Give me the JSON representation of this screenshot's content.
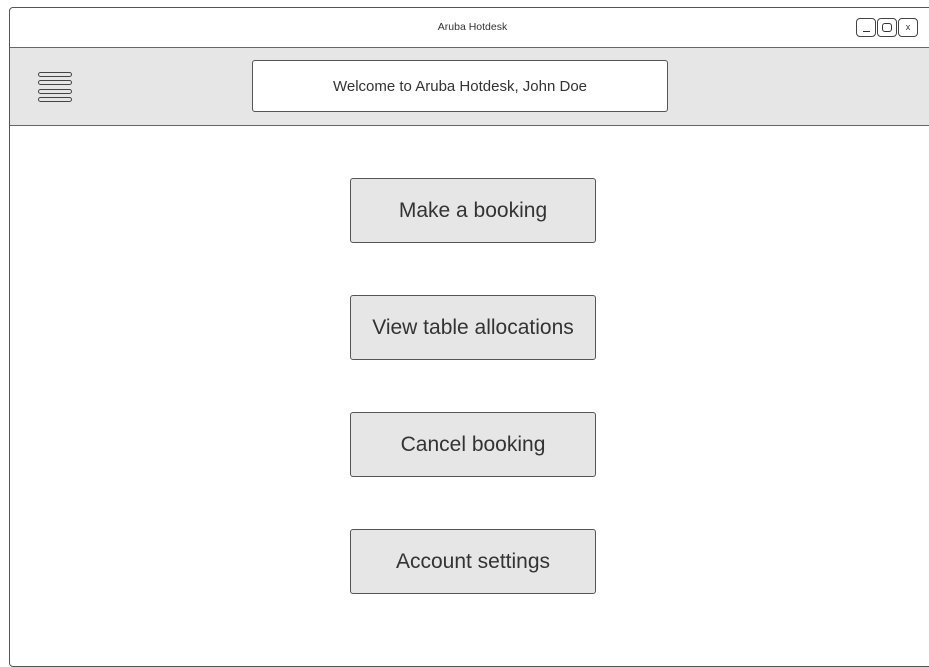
{
  "window": {
    "title": "Aruba Hotdesk",
    "controls": {
      "minimize": "_",
      "maximize": "",
      "close": "x"
    }
  },
  "header": {
    "menu_icon": "hamburger-menu-icon",
    "welcome_text": "Welcome to Aruba Hotdesk, John Doe"
  },
  "main": {
    "buttons": [
      {
        "label": "Make a booking"
      },
      {
        "label": "View table allocations"
      },
      {
        "label": "Cancel booking"
      },
      {
        "label": "Account settings"
      }
    ]
  },
  "colors": {
    "panel_gray": "#e6e6e6",
    "border": "#555555",
    "text": "#333333",
    "background": "#ffffff"
  }
}
